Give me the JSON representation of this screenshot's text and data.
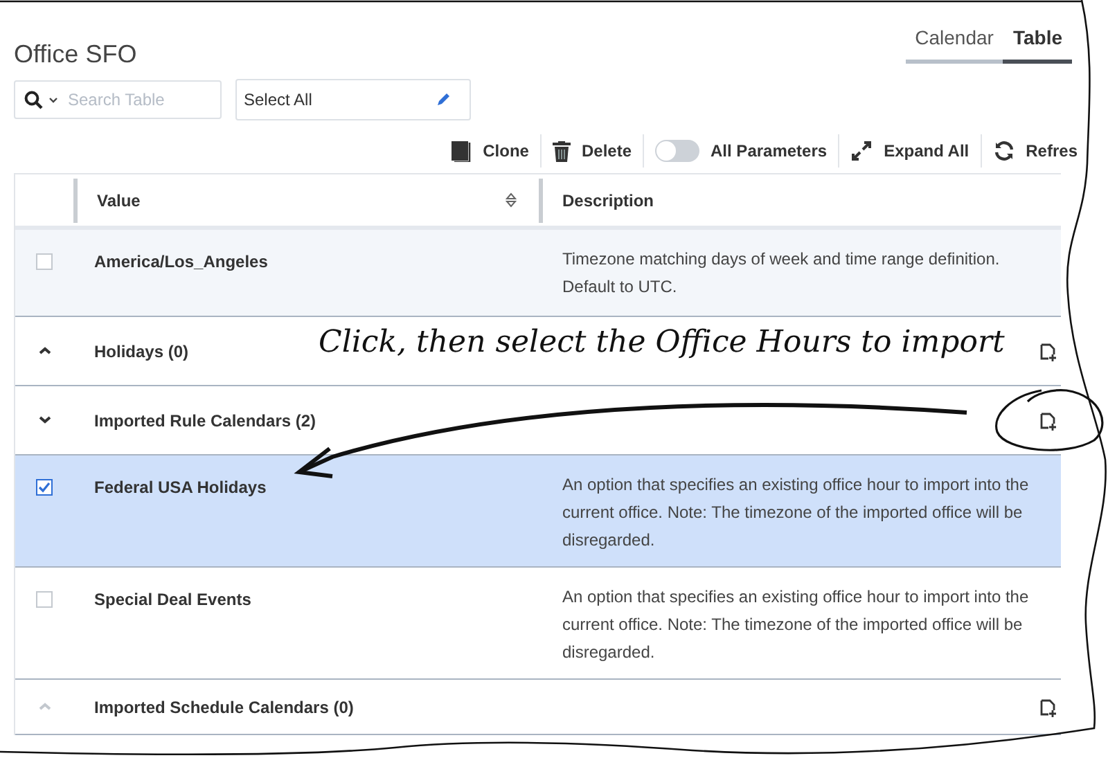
{
  "title": "Office SFO",
  "tabs": [
    {
      "label": "Calendar",
      "selected": false
    },
    {
      "label": "Table",
      "selected": true
    }
  ],
  "search": {
    "placeholder": "Search Table"
  },
  "select_field": {
    "value": "Select All"
  },
  "toolbar": [
    {
      "kind": "button",
      "label": "Clone"
    },
    {
      "kind": "button",
      "label": "Delete"
    },
    {
      "kind": "toggle",
      "label": "All Parameters",
      "on": false
    },
    {
      "kind": "button",
      "label": "Expand All"
    },
    {
      "kind": "button",
      "label": "Refres"
    }
  ],
  "table": {
    "columns": [
      "Value",
      "Description"
    ],
    "rows": [
      {
        "kind": "item",
        "value": "America/Los_Angeles",
        "description": "Timezone matching days of week and time range definition. Default to UTC.",
        "checked": false,
        "selected": false,
        "hovered": true
      },
      {
        "kind": "group",
        "label": "Holidays (0)",
        "expanded": false,
        "disabled": false
      },
      {
        "kind": "group",
        "label": "Imported Rule Calendars (2)",
        "expanded": true,
        "disabled": false
      },
      {
        "kind": "item",
        "value": "Federal USA Holidays",
        "description": "An option that specifies an existing office hour to import into the current office. Note: The timezone of the imported office will be disregarded.",
        "checked": true,
        "selected": true,
        "hovered": false
      },
      {
        "kind": "item",
        "value": "Special Deal Events",
        "description": "An option that specifies an existing office hour to import into the current office. Note: The timezone of the imported office will be disregarded.",
        "checked": false,
        "selected": false,
        "hovered": false
      },
      {
        "kind": "group",
        "label": "Imported Schedule Calendars (0)",
        "expanded": false,
        "disabled": true
      }
    ]
  },
  "annotation": {
    "text": "Click, then select the Office Hours to import"
  }
}
